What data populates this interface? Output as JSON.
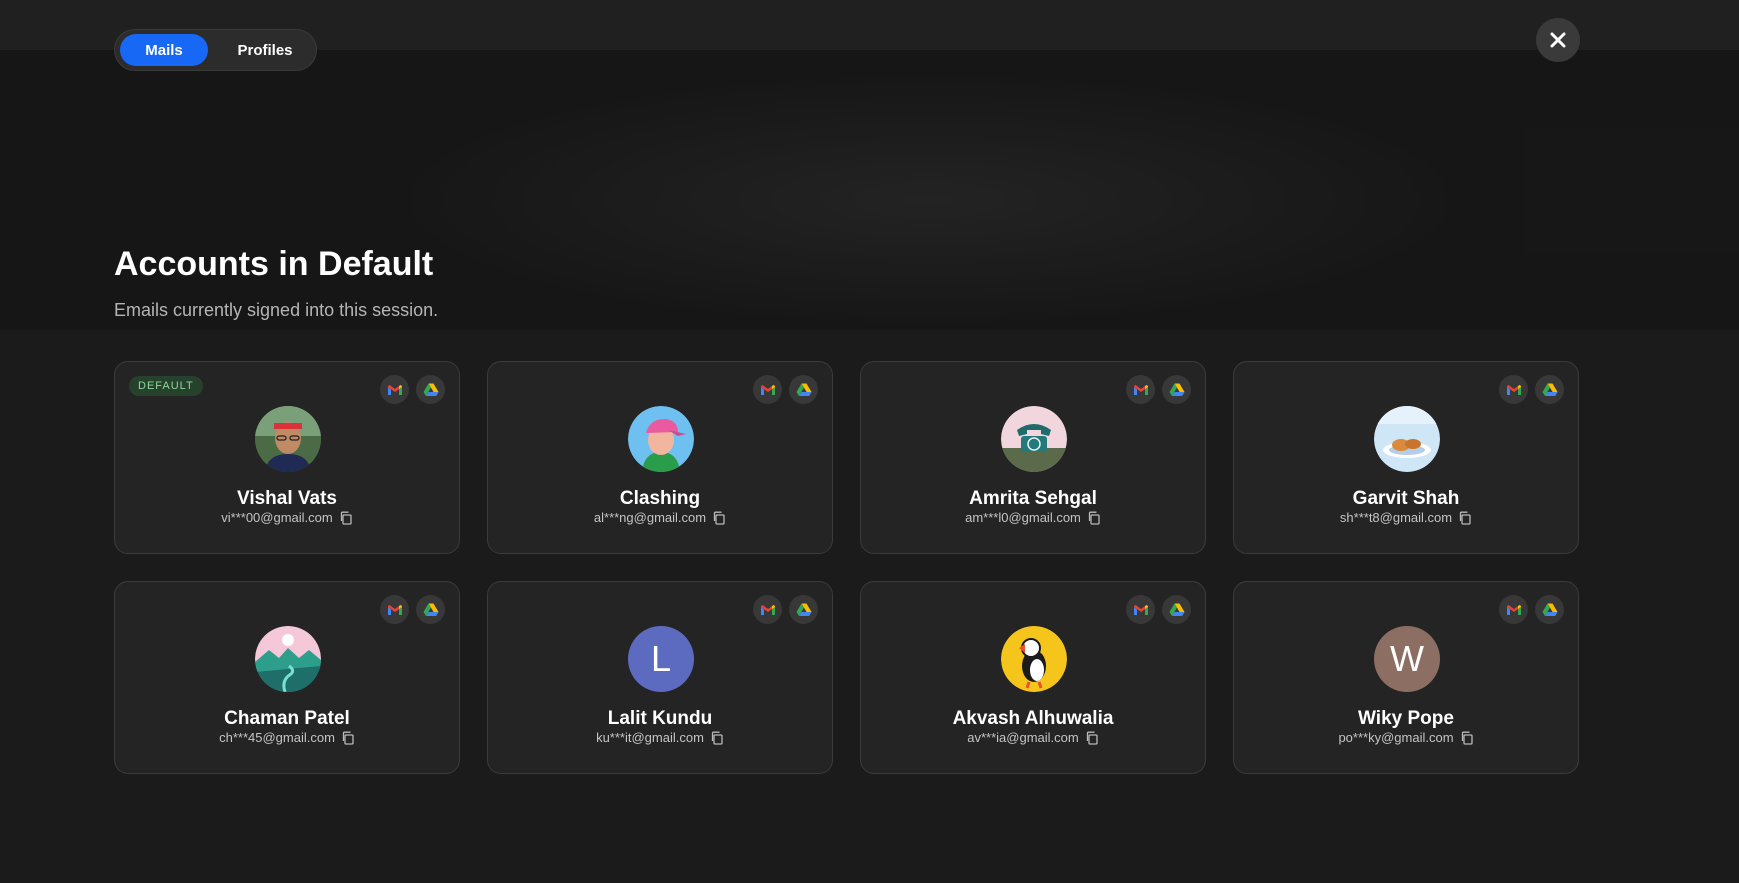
{
  "toggle": {
    "mails_label": "Mails",
    "profiles_label": "Profiles",
    "selected": "Mails"
  },
  "close": {
    "icon": "close-icon"
  },
  "header": {
    "title": "Accounts in Default",
    "subtitle": "Emails currently signed into this session."
  },
  "colors": {
    "accent": "#1769f5",
    "badge_bg": "#26422c",
    "badge_text": "#8fd69c",
    "card_bg": "#242424",
    "page_bg": "#1b1b1b"
  },
  "accounts": [
    {
      "name": "Vishal Vats",
      "email": "vi***00@gmail.com",
      "badge": "DEFAULT",
      "avatar": "photo-person-icon",
      "avatar_color": "#3d6b3a"
    },
    {
      "name": "Clashing",
      "email": "al***ng@gmail.com",
      "avatar": "cartoon-cap-icon",
      "avatar_color": "#6ec0f0"
    },
    {
      "name": "Amrita Sehgal",
      "email": "am***l0@gmail.com",
      "avatar": "telephone-icon",
      "avatar_color": "#f2d6de"
    },
    {
      "name": "Garvit Shah",
      "email": "sh***t8@gmail.com",
      "avatar": "food-plate-icon",
      "avatar_color": "#cfe6f7"
    },
    {
      "name": "Chaman Patel",
      "email": "ch***45@gmail.com",
      "avatar": "landscape-icon",
      "avatar_color": "#f4c8d8"
    },
    {
      "name": "Lalit Kundu",
      "email": "ku***it@gmail.com",
      "avatar_letter": "L",
      "avatar_color": "#5c6bc0"
    },
    {
      "name": "Akvash Alhuwalia",
      "email": "av***ia@gmail.com",
      "avatar": "puffin-icon",
      "avatar_color": "#f6c51c"
    },
    {
      "name": "Wiky Pope",
      "email": "po***ky@gmail.com",
      "avatar_letter": "W",
      "avatar_color": "#8d6e63"
    }
  ],
  "service_icons": [
    "gmail-icon",
    "google-drive-icon"
  ]
}
